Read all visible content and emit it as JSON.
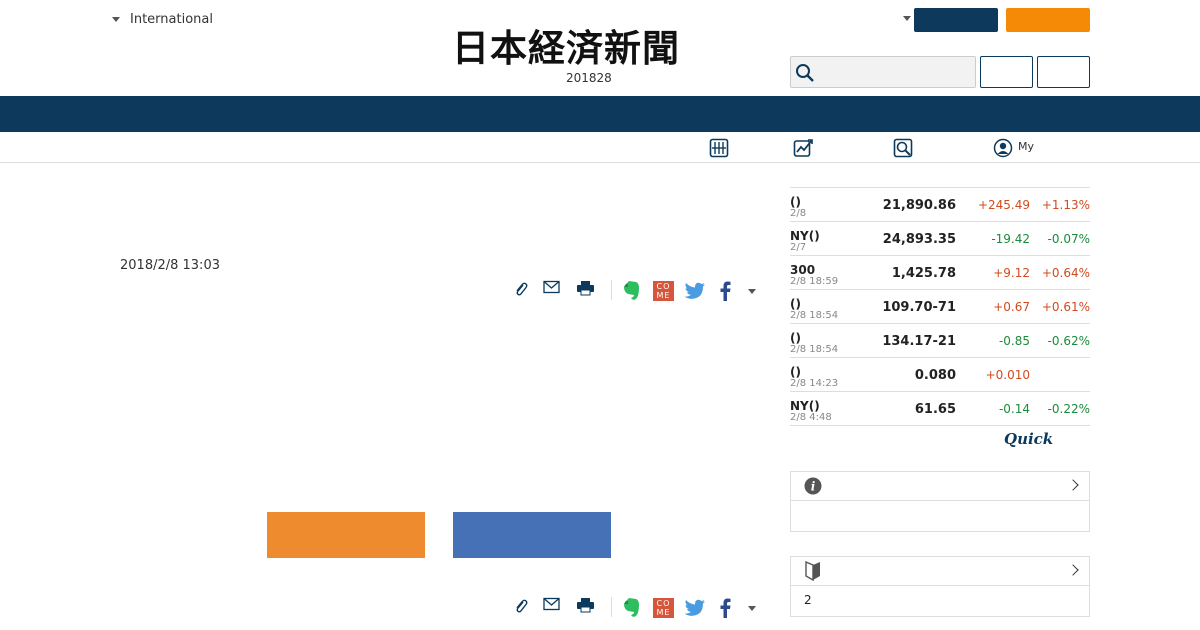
{
  "header": {
    "edition_label": "International",
    "logo_text": "日本経済新聞",
    "date_line": "201828"
  },
  "subnav": {
    "my_label": "My"
  },
  "article": {
    "date": "2018/2/8 13:03"
  },
  "share": {
    "come_text": "CO ME"
  },
  "markets": [
    {
      "name": "()",
      "date": "2/8",
      "value": "21,890.86",
      "change": "+245.49",
      "pct": "+1.13%",
      "dir": "up"
    },
    {
      "name": "NY()",
      "date": "2/7",
      "value": "24,893.35",
      "change": "-19.42",
      "pct": "-0.07%",
      "dir": "down"
    },
    {
      "name": "300",
      "date": "2/8 18:59",
      "value": "1,425.78",
      "change": "+9.12",
      "pct": "+0.64%",
      "dir": "up"
    },
    {
      "name": "()",
      "date": "2/8 18:54",
      "value": "109.70-71",
      "change": "+0.67",
      "pct": "+0.61%",
      "dir": "up"
    },
    {
      "name": "()",
      "date": "2/8 18:54",
      "value": "134.17-21",
      "change": "-0.85",
      "pct": "-0.62%",
      "dir": "down"
    },
    {
      "name": "()",
      "date": "2/8 14:23",
      "value": "0.080",
      "change": "+0.010",
      "pct": "",
      "dir": "up"
    },
    {
      "name": "NY()",
      "date": "2/8 4:48",
      "value": "61.65",
      "change": "-0.14",
      "pct": "-0.22%",
      "dir": "down"
    }
  ],
  "quick_logo": "Quick",
  "boxes": [
    {
      "icon": "info-icon",
      "body": ""
    },
    {
      "icon": "beginner-mark-icon",
      "body": "2"
    }
  ],
  "colors": {
    "navy": "#0d3a5c",
    "orange": "#f58a07",
    "up": "#d14b1e",
    "down": "#1a8c3c"
  }
}
